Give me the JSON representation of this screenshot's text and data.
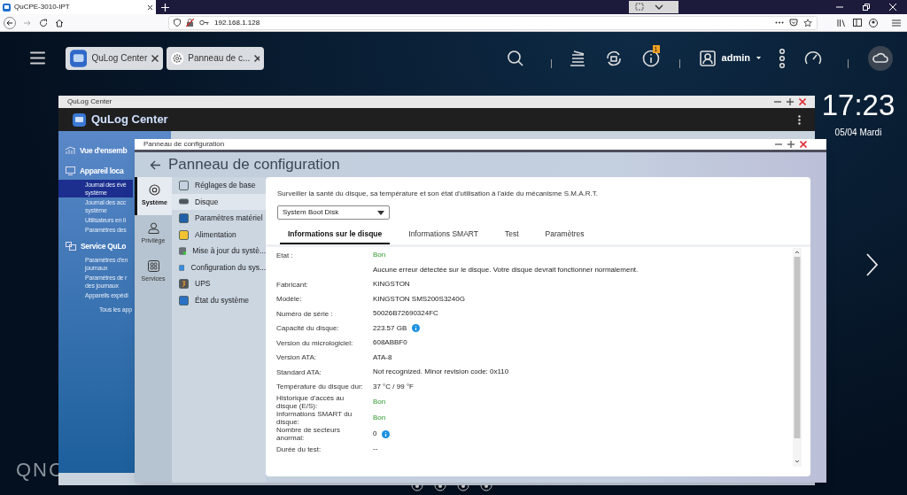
{
  "browser": {
    "tab_title": "QuCPE-3010-IPT",
    "url": "192.168.1.128"
  },
  "topbar": {
    "tabs": [
      {
        "label": "QuLog Center"
      },
      {
        "label": "Panneau de c..."
      }
    ],
    "notification_count": "1",
    "user": "admin"
  },
  "clock": {
    "time": "17:23",
    "date": "05/04 Mardi"
  },
  "logo": "QNC",
  "qulog": {
    "title": "QuLog Center",
    "app_title": "QuLog Center",
    "sidebar": [
      {
        "kind": "section",
        "lines": [
          "Vue d'ensemb"
        ],
        "selected": false
      },
      {
        "kind": "section",
        "lines": [
          "Appareil loca"
        ],
        "selected": false
      },
      {
        "kind": "item",
        "lines": [
          "Journal des évé",
          "système"
        ],
        "selected": true
      },
      {
        "kind": "item",
        "lines": [
          "Journal des acc",
          "système"
        ],
        "selected": false
      },
      {
        "kind": "item",
        "lines": [
          "Utilisateurs en li"
        ],
        "selected": false
      },
      {
        "kind": "item",
        "lines": [
          "Paramètres des"
        ],
        "selected": false
      },
      {
        "kind": "section",
        "lines": [
          "Service QuLo"
        ],
        "selected": false
      },
      {
        "kind": "item",
        "lines": [
          "Paramètres d'en",
          "journaux"
        ],
        "selected": false
      },
      {
        "kind": "item",
        "lines": [
          "Paramètres de r",
          "des journaux"
        ],
        "selected": false
      },
      {
        "kind": "item",
        "lines": [
          "Appareils expédi"
        ],
        "selected": false
      },
      {
        "kind": "link",
        "lines": [
          "Tous les app"
        ],
        "selected": false
      }
    ]
  },
  "panel": {
    "title": "Panneau de configuration",
    "heading": "Panneau de configuration",
    "rail": [
      {
        "label": "Système",
        "selected": true
      },
      {
        "label": "Privilège",
        "selected": false
      },
      {
        "label": "Services",
        "selected": false
      }
    ],
    "menu": [
      {
        "label": "Réglages de base",
        "selected": false
      },
      {
        "label": "Disque",
        "selected": true
      },
      {
        "label": "Paramètres matériel",
        "selected": false
      },
      {
        "label": "Alimentation",
        "selected": false
      },
      {
        "label": "Mise à jour du systè...",
        "selected": false
      },
      {
        "label": "Configuration du sys...",
        "selected": false
      },
      {
        "label": "UPS",
        "selected": false
      },
      {
        "label": "État du système",
        "selected": false
      }
    ],
    "description": "Surveiller la santé du disque, sa température et son état d'utilisation à l'aide du mécanisme S.M.A.R.T.",
    "disk_select": "System Boot Disk",
    "tabs": [
      {
        "label": "Informations sur le disque",
        "selected": true
      },
      {
        "label": "Informations SMART",
        "selected": false
      },
      {
        "label": "Test",
        "selected": false
      },
      {
        "label": "Paramètres",
        "selected": false
      }
    ],
    "rows": [
      {
        "label": "Etat :",
        "value": "Bon",
        "kind": "status"
      },
      {
        "value": "Aucune erreur détectée sur le disque. Votre disque devrait fonctionner normalement.",
        "kind": "text"
      },
      {
        "label": "Fabricant:",
        "value": "KINGSTON",
        "kind": "text"
      },
      {
        "label": "Modèle:",
        "value": "KINGSTON SMS200S3240G",
        "kind": "text"
      },
      {
        "label": "Numéro de série :",
        "value": "50026B72690324FC",
        "kind": "text"
      },
      {
        "label": "Capacité du disque:",
        "value": "223.57 GB",
        "kind": "text",
        "info": true
      },
      {
        "label": "Version du micrologiciel:",
        "value": "608ABBF0",
        "kind": "text"
      },
      {
        "label": "Version ATA:",
        "value": "ATA-8",
        "kind": "text"
      },
      {
        "label": "Standard ATA:",
        "value": "Not recognized. Minor revision code: 0x110",
        "kind": "text"
      },
      {
        "label": "Température du disque dur:",
        "value": "37 °C / 99 °F",
        "kind": "text"
      },
      {
        "label": "Historique d'accès au disque (E/S):",
        "value": "Bon",
        "kind": "status"
      },
      {
        "label": "Informations SMART du disque:",
        "value": "Bon",
        "kind": "status"
      },
      {
        "label": "Nombre de secteurs anormal:",
        "value": "0",
        "kind": "text",
        "info": true
      },
      {
        "label": "Durée du test:",
        "value": "--",
        "kind": "text"
      }
    ]
  }
}
